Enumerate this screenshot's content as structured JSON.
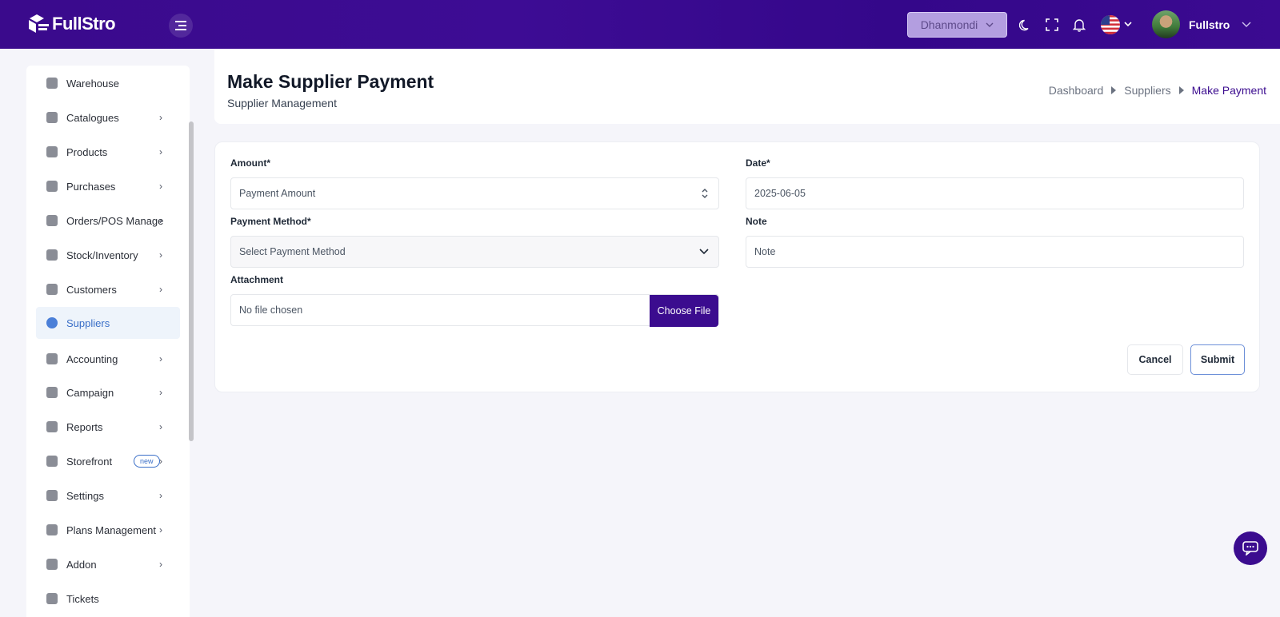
{
  "app": {
    "logo_text": "FullStro"
  },
  "topbar": {
    "branch": "Dhanmondi",
    "user_name": "Fullstro"
  },
  "sidebar": {
    "items": [
      {
        "label": "Warehouse",
        "icon": "warehouse-icon",
        "has_children": false
      },
      {
        "label": "Catalogues",
        "icon": "catalogue-icon",
        "has_children": true
      },
      {
        "label": "Products",
        "icon": "cart-icon",
        "has_children": true
      },
      {
        "label": "Purchases",
        "icon": "bag-icon",
        "has_children": true
      },
      {
        "label": "Orders/POS Manage",
        "icon": "clipboard-icon",
        "has_children": true
      },
      {
        "label": "Stock/Inventory",
        "icon": "box-icon",
        "has_children": true
      },
      {
        "label": "Customers",
        "icon": "users-icon",
        "has_children": true
      },
      {
        "label": "Suppliers",
        "icon": "supplier-icon",
        "has_children": false,
        "active": true
      },
      {
        "label": "Accounting",
        "icon": "wallet-icon",
        "has_children": true
      },
      {
        "label": "Campaign",
        "icon": "megaphone-icon",
        "has_children": true
      },
      {
        "label": "Reports",
        "icon": "report-icon",
        "has_children": true
      },
      {
        "label": "Storefront",
        "icon": "store-icon",
        "has_children": true,
        "badge": "new"
      },
      {
        "label": "Settings",
        "icon": "gear-icon",
        "has_children": true
      },
      {
        "label": "Plans Management",
        "icon": "plan-icon",
        "has_children": true
      },
      {
        "label": "Addon",
        "icon": "link-icon",
        "has_children": true
      },
      {
        "label": "Tickets",
        "icon": "ticket-icon",
        "has_children": false
      }
    ]
  },
  "page": {
    "title": "Make Supplier Payment",
    "subtitle": "Supplier Management",
    "breadcrumb": [
      "Dashboard",
      "Suppliers",
      "Make Payment"
    ]
  },
  "form": {
    "amount_label": "Amount*",
    "amount_placeholder": "Payment Amount",
    "date_label": "Date*",
    "date_value": "2025-06-05",
    "method_label": "Payment Method*",
    "method_placeholder": "Select Payment Method",
    "note_label": "Note",
    "note_placeholder": "Note",
    "attachment_label": "Attachment",
    "file_status": "No file chosen",
    "file_button": "Choose File",
    "cancel_label": "Cancel",
    "submit_label": "Submit"
  },
  "colors": {
    "brand": "#3b0c8f",
    "active_link": "#3a6fc8",
    "page_bg": "#f5f5fa"
  }
}
